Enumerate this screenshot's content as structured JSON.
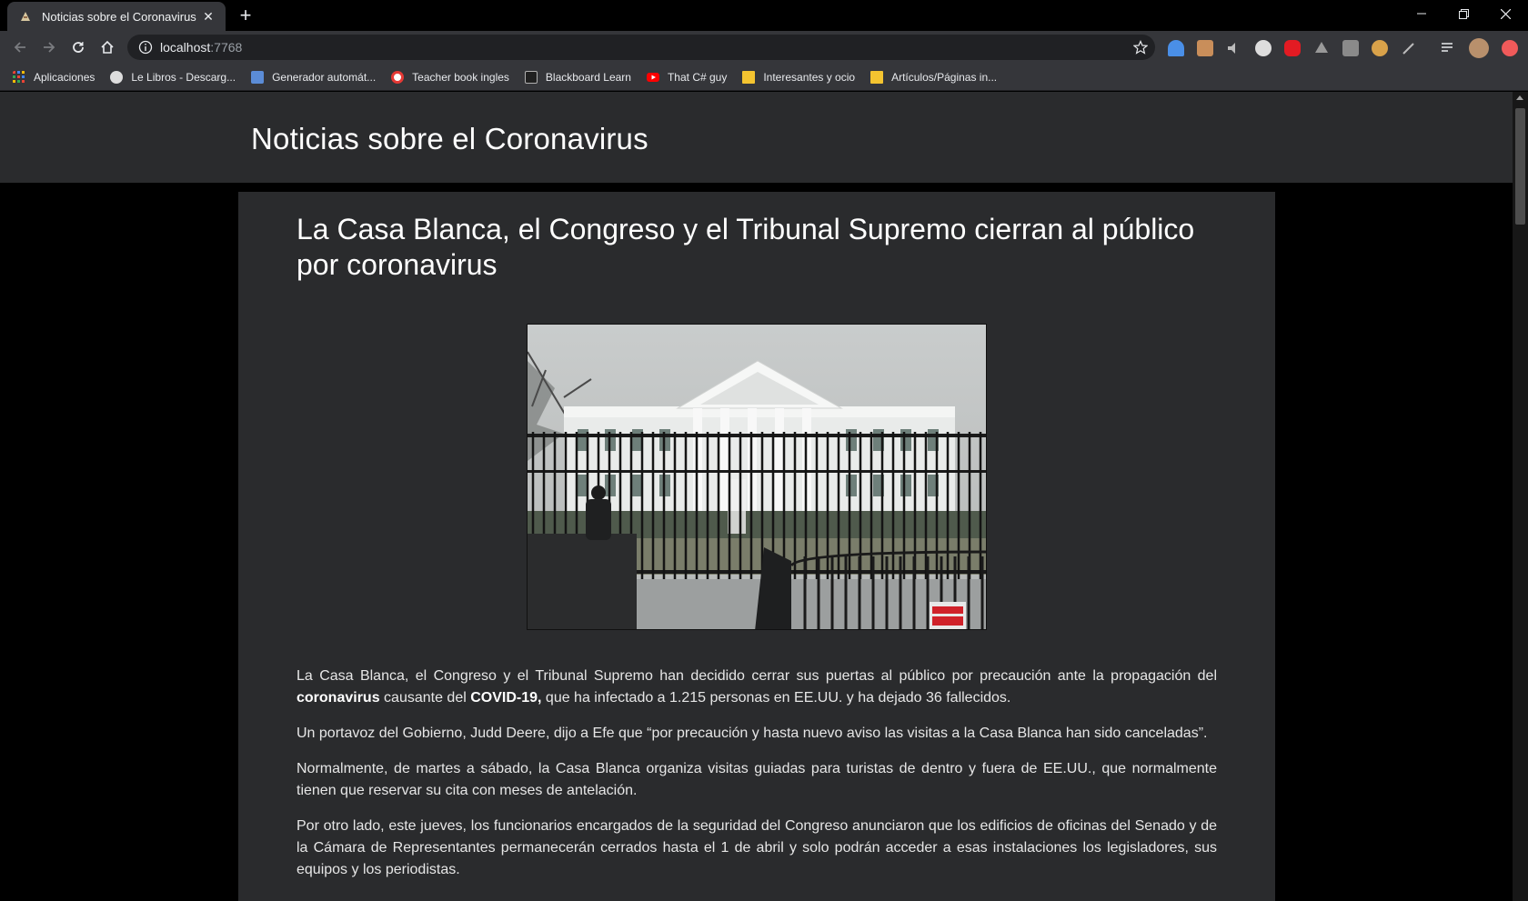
{
  "browser": {
    "tab": {
      "title": "Noticias sobre el Coronavirus"
    },
    "address": {
      "host": "localhost",
      "port": ":7768"
    },
    "bookmarks": [
      {
        "label": "Aplicaciones",
        "icon": "apps-grid-icon",
        "color": "#ea4335"
      },
      {
        "label": "Le Libros - Descarg...",
        "icon": "globe-icon",
        "color": "#dddddd"
      },
      {
        "label": "Generador automát...",
        "icon": "document-icon",
        "color": "#5b8cd6"
      },
      {
        "label": "Teacher book ingles",
        "icon": "target-icon",
        "color": "#e53935"
      },
      {
        "label": "Blackboard Learn",
        "icon": "blackboard-icon",
        "color": "#b0b0b0"
      },
      {
        "label": "That C# guy",
        "icon": "youtube-icon",
        "color": "#ff0000"
      },
      {
        "label": "Interesantes y ocio",
        "icon": "folder-icon",
        "color": "#f4c430"
      },
      {
        "label": "Artículos/Páginas in...",
        "icon": "folder-icon",
        "color": "#f4c430"
      }
    ]
  },
  "page": {
    "site_title": "Noticias sobre el Coronavirus",
    "headline": "La Casa Blanca, el Congreso y el Tribunal Supremo cierran al público por coronavirus",
    "image_subject": "white-house-photo",
    "p1_a": "La Casa Blanca, el Congreso y el Tribunal Supremo han decidido cerrar sus puertas al público por precaución ante la propagación del ",
    "p1_b1": "coronavirus",
    "p1_c": " causante del ",
    "p1_b2": "COVID-19,",
    "p1_d": " que ha infectado a 1.215 personas en EE.UU. y ha dejado 36 fallecidos.",
    "p2": "Un portavoz del Gobierno, Judd Deere, dijo a Efe que “por precaución y hasta nuevo aviso las visitas a la Casa Blanca han sido canceladas”.",
    "p3": "Normalmente, de martes a sábado, la Casa Blanca organiza visitas guiadas para turistas de dentro y fuera de EE.UU., que normalmente tienen que reservar su cita con meses de antelación.",
    "p4": "Por otro lado, este jueves, los funcionarios encargados de la seguridad del Congreso anunciaron que los edificios de oficinas del Senado y de la Cámara de Representantes permanecerán cerrados hasta el 1 de abril y solo podrán acceder a esas instalaciones los legisladores, sus equipos y los periodistas."
  }
}
